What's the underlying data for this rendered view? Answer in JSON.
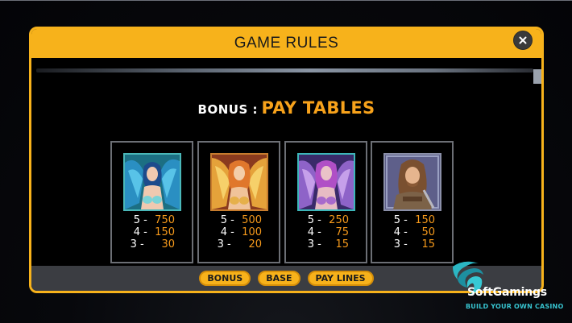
{
  "modal": {
    "title": "GAME RULES",
    "close_icon": "close-icon"
  },
  "heading": {
    "prefix": "BONUS :",
    "main": "PAY TABLES"
  },
  "colors": {
    "accent": "#f7b21b",
    "value_orange": "#f79a1b",
    "teal": "#37c3cf"
  },
  "paytable": [
    {
      "symbol": "blue-winged-angel",
      "rows": [
        {
          "label": "5 - ",
          "value": "750"
        },
        {
          "label": "4 - ",
          "value": "150"
        },
        {
          "label": "3 -  ",
          "value": "30"
        }
      ]
    },
    {
      "symbol": "golden-winged-angel",
      "rows": [
        {
          "label": "5 - ",
          "value": "500"
        },
        {
          "label": "4 - ",
          "value": "100"
        },
        {
          "label": "3 -  ",
          "value": "20"
        }
      ]
    },
    {
      "symbol": "purple-winged-angel",
      "rows": [
        {
          "label": "5 - ",
          "value": "250"
        },
        {
          "label": "4 - ",
          "value": "75"
        },
        {
          "label": "3 - ",
          "value": "15"
        }
      ]
    },
    {
      "symbol": "long-haired-warrior",
      "rows": [
        {
          "label": "5 - ",
          "value": "150"
        },
        {
          "label": "4 - ",
          "value": "50"
        },
        {
          "label": "3 - ",
          "value": "15"
        }
      ]
    }
  ],
  "tabs": [
    "BONUS",
    "BASE",
    "PAY LINES"
  ],
  "brand": {
    "name": "SoftGamings",
    "tagline": "BUILD YOUR OWN CASINO"
  }
}
